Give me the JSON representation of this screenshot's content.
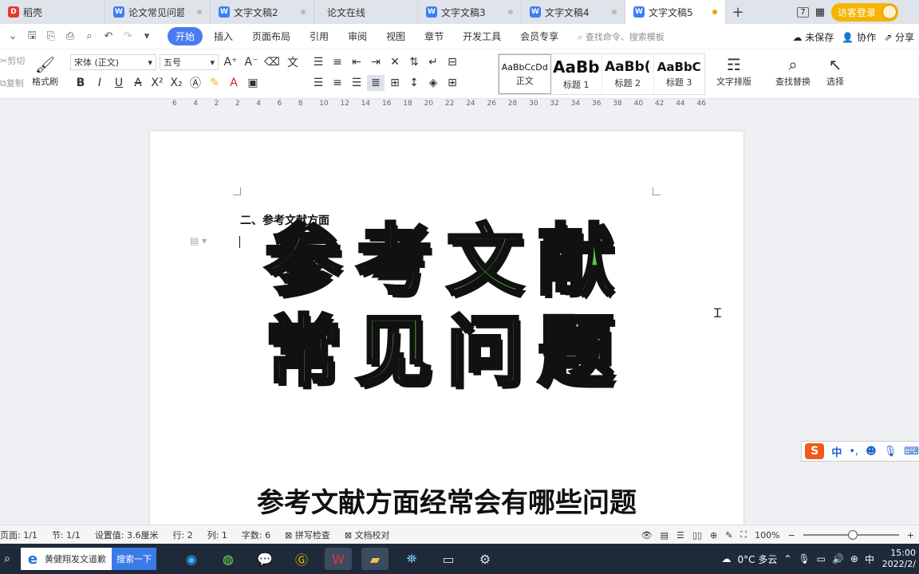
{
  "tabs": [
    {
      "label": "稻壳",
      "icon": "docer-icon",
      "color": "#e23b2e"
    },
    {
      "label": "论文常见问题",
      "icon": "wps-writer-icon",
      "color": "#3d7ef7"
    },
    {
      "label": "文字文稿2",
      "icon": "wps-writer-icon",
      "color": "#3d7ef7"
    },
    {
      "label": "论文在线",
      "icon": "",
      "color": ""
    },
    {
      "label": "文字文稿3",
      "icon": "wps-writer-icon",
      "color": "#3d7ef7"
    },
    {
      "label": "文字文稿4",
      "icon": "wps-writer-icon",
      "color": "#3d7ef7"
    },
    {
      "label": "文字文稿5",
      "icon": "wps-writer-icon",
      "color": "#3d7ef7"
    }
  ],
  "titlebar": {
    "badge": "7",
    "guest_login": "访客登录"
  },
  "menu": {
    "tabs": [
      "开始",
      "插入",
      "页面布局",
      "引用",
      "审阅",
      "视图",
      "章节",
      "开发工具",
      "会员专享"
    ],
    "active": "开始",
    "search": "查找命令、搜索模板",
    "unsaved": "未保存",
    "collab": "协作",
    "share": "分享"
  },
  "ribbon": {
    "cut": "剪切",
    "copy": "复制",
    "format_painter": "格式刷",
    "font_name": "宋体 (正文)",
    "font_size": "五号",
    "styles": [
      {
        "sample": "AaBbCcDd",
        "name": "正文"
      },
      {
        "sample": "AaBb",
        "name": "标题 1"
      },
      {
        "sample": "AaBb(",
        "name": "标题 2"
      },
      {
        "sample": "AaBbC",
        "name": "标题 3"
      }
    ],
    "text_layout": "文字排版",
    "find_replace": "查找替换",
    "select": "选择"
  },
  "ruler": [
    "6",
    "4",
    "2",
    "2",
    "4",
    "6",
    "8",
    "10",
    "12",
    "14",
    "16",
    "18",
    "20",
    "22",
    "24",
    "26",
    "28",
    "30",
    "32",
    "34",
    "36",
    "38",
    "40",
    "42",
    "44",
    "46"
  ],
  "document": {
    "heading": "二、参考文献方面",
    "overlay_line1": "参考文献",
    "overlay_line2": "常见问题",
    "subtitle": "参考文献方面经常会有哪些问题"
  },
  "ime": {
    "lang": "中",
    "punct": "•,"
  },
  "status": {
    "page": "页面: 1/1",
    "section": "节: 1/1",
    "setting": "设置值: 3.6厘米",
    "row": "行: 2",
    "col": "列: 1",
    "words": "字数: 6",
    "spell": "拼写检查",
    "proof": "文档校对",
    "zoom": "100%",
    "zoom_level": 0.52
  },
  "taskbar": {
    "search_text": "黄健翔发文道歉",
    "search_button": "搜索一下",
    "weather": "0°C 多云",
    "time": "15:00",
    "date": "2022/2/"
  }
}
